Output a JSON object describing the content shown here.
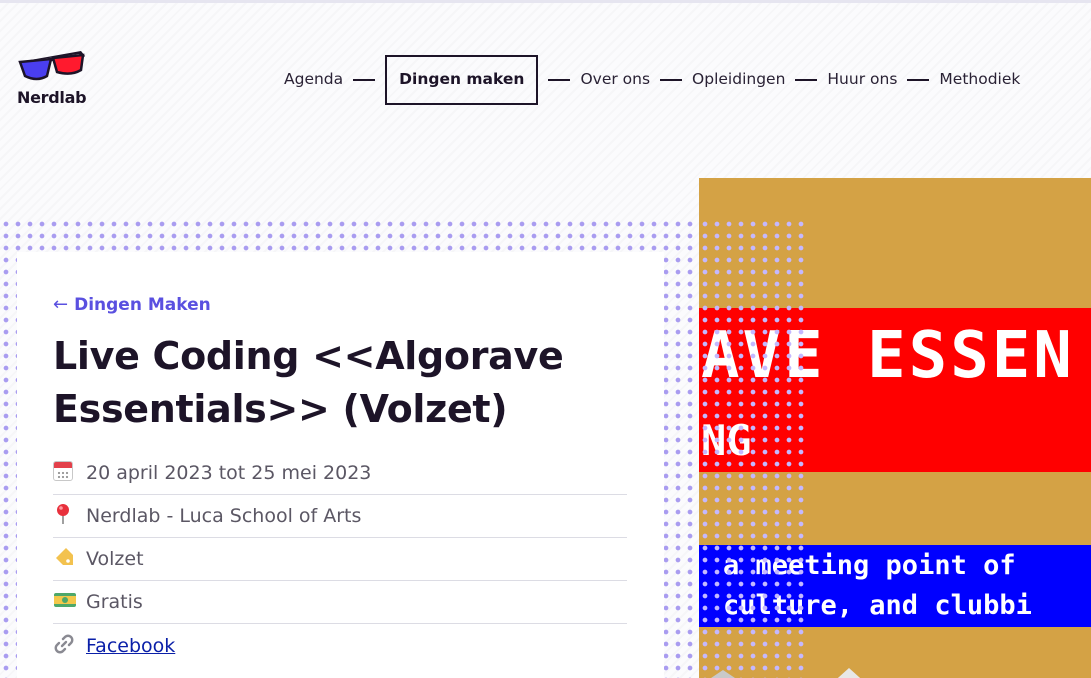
{
  "header": {
    "logo_text": "Nerdlab",
    "nav": [
      {
        "label": "Agenda"
      },
      {
        "label": "Dingen maken",
        "active": true
      },
      {
        "label": "Over ons"
      },
      {
        "label": "Opleidingen"
      },
      {
        "label": "Huur ons"
      },
      {
        "label": "Methodiek"
      }
    ]
  },
  "card": {
    "back_label": "Dingen Maken",
    "back_icon": "arrow-left-icon",
    "title": "Live Coding <<Algorave Essentials>> (Volzet)",
    "meta": [
      {
        "icon": "calendar-icon",
        "text": "20 april 2023 tot 25 mei 2023"
      },
      {
        "icon": "pin-icon",
        "text": "Nerdlab - Luca School of Arts"
      },
      {
        "icon": "tag-icon",
        "text": "Volzet"
      },
      {
        "icon": "money-icon",
        "text": "Gratis"
      },
      {
        "icon": "link-icon",
        "text": "Facebook",
        "is_link": true
      }
    ]
  },
  "poster": {
    "big_text": "AVE ESSEN",
    "sub_text": "NG",
    "line1": "a meeting point of",
    "line2": "culture, and clubbi"
  },
  "colors": {
    "accent": "#5a50e0",
    "dots": "#a99cf0",
    "poster_bg": "#d4a245",
    "poster_red": "#ff0000",
    "poster_blue": "#0000ff",
    "text_dark": "#1d1428"
  }
}
